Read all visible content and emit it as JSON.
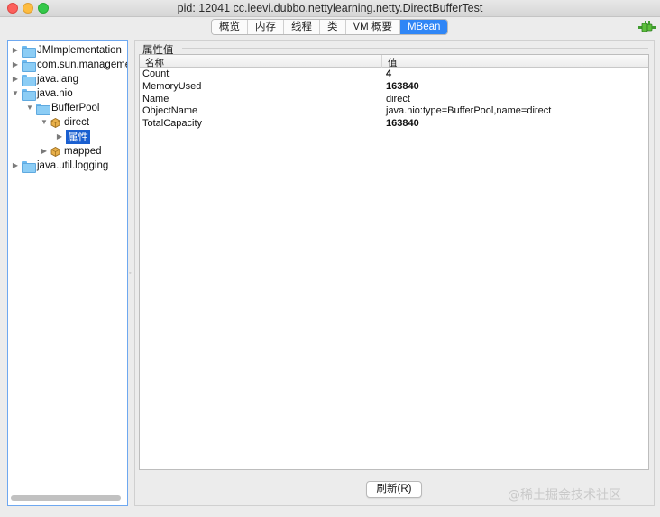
{
  "window": {
    "title": "pid: 12041 cc.leevi.dubbo.nettylearning.netty.DirectBufferTest"
  },
  "tabs": [
    {
      "label": "概览"
    },
    {
      "label": "内存"
    },
    {
      "label": "线程"
    },
    {
      "label": "类"
    },
    {
      "label": "VM 概要"
    },
    {
      "label": "MBean",
      "active": true
    }
  ],
  "tree": {
    "items": [
      {
        "label": "JMImplementation",
        "arrow": "▶",
        "icon": "folder-icon"
      },
      {
        "label": "com.sun.manageme",
        "arrow": "▶",
        "icon": "folder-icon"
      },
      {
        "label": "java.lang",
        "arrow": "▶",
        "icon": "folder-icon"
      },
      {
        "label": "java.nio",
        "arrow": "▼",
        "icon": "folder-icon"
      },
      {
        "label": "BufferPool",
        "arrow": "▼",
        "icon": "folder-icon"
      },
      {
        "label": "direct",
        "arrow": "▼",
        "icon": "bean-icon"
      },
      {
        "label": "属性",
        "arrow": "▶",
        "icon": "none",
        "selected": true
      },
      {
        "label": "mapped",
        "arrow": "▶",
        "icon": "bean-icon"
      },
      {
        "label": "java.util.logging",
        "arrow": "▶",
        "icon": "folder-icon"
      }
    ]
  },
  "attributes": {
    "group_title": "属性值",
    "columns": [
      "名称",
      "值"
    ],
    "rows": [
      {
        "name": "Count",
        "value": "4",
        "bold": true
      },
      {
        "name": "MemoryUsed",
        "value": "163840",
        "bold": true
      },
      {
        "name": "Name",
        "value": "direct",
        "bold": false
      },
      {
        "name": "ObjectName",
        "value": "java.nio:type=BufferPool,name=direct",
        "bold": false
      },
      {
        "name": "TotalCapacity",
        "value": "163840",
        "bold": true
      }
    ],
    "refresh_label": "刷新(R)"
  },
  "watermark": "@稀土掘金技术社区",
  "colors": {
    "accent": "#2f86f6",
    "selection": "#1a5fd0"
  }
}
